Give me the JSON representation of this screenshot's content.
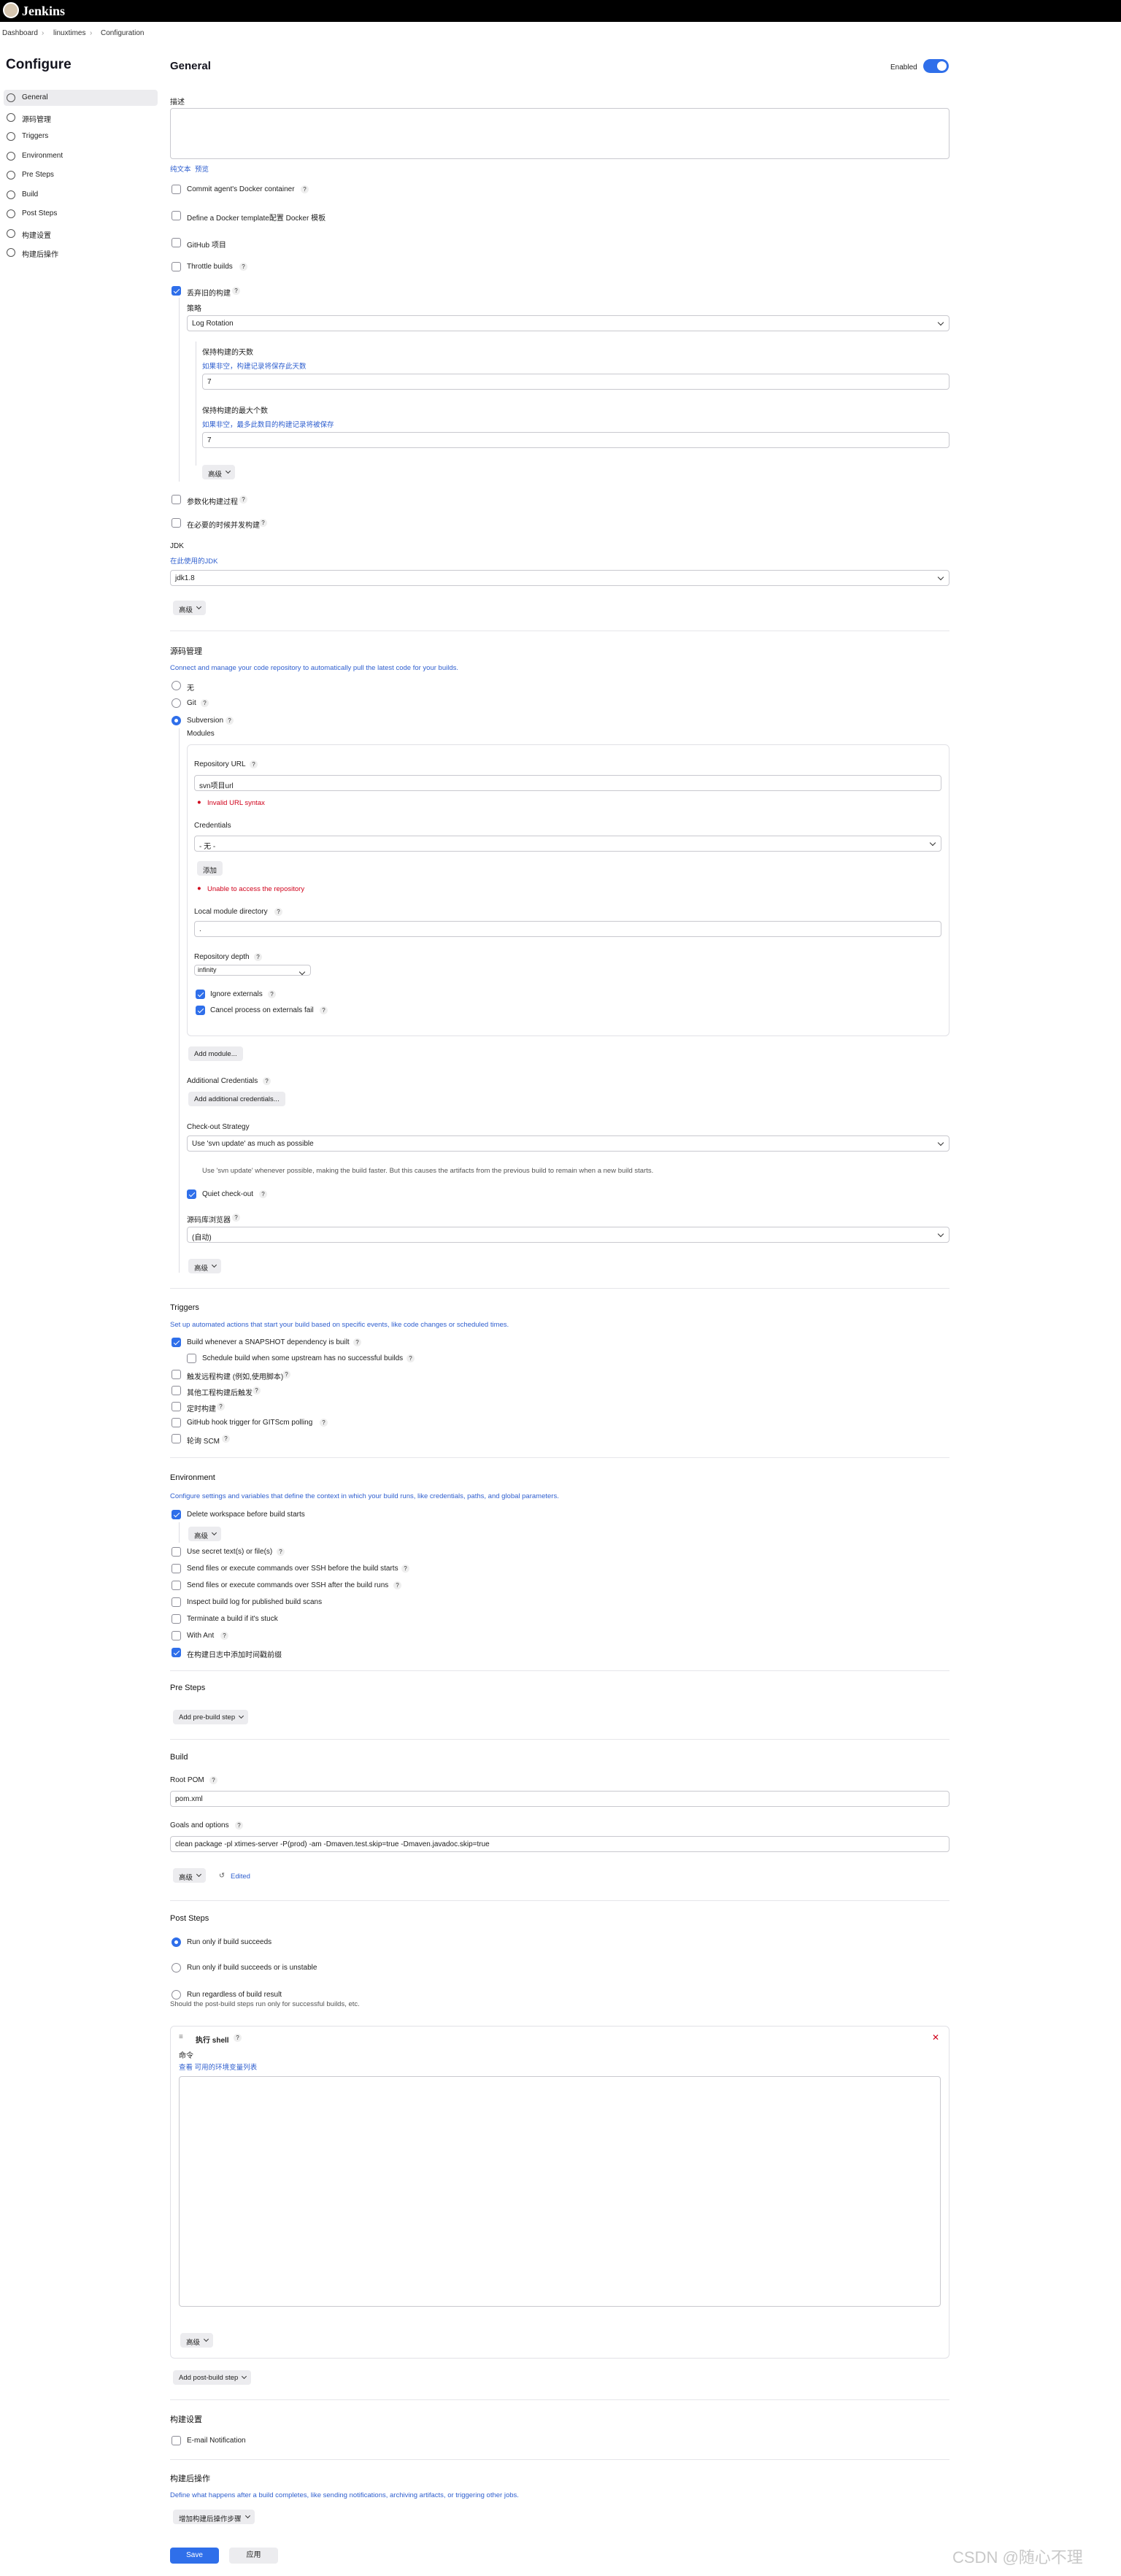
{
  "app": {
    "brand": "Jenkins"
  },
  "breadcrumb": [
    "Dashboard",
    "linuxtimes",
    "Configuration"
  ],
  "page_title": "Configure",
  "sidebar": [
    "General",
    "源码管理",
    "Triggers",
    "Environment",
    "Pre Steps",
    "Build",
    "Post Steps",
    "构建设置",
    "构建后操作"
  ],
  "general": {
    "title": "General",
    "enabled": "Enabled",
    "desc_label": "描述",
    "plain_text": "纯文本",
    "preview": "预览",
    "opts": [
      "Commit agent's Docker container",
      "Define a Docker template配置 Docker 模板",
      "GitHub 项目",
      "Throttle builds",
      "丢弃旧的构建"
    ],
    "strategy_label": "策略",
    "strategy": "Log Rotation",
    "keep_days_label": "保持构建的天数",
    "keep_days_hint": "如果非空，构建记录将保存此天数",
    "keep_days": "7",
    "keep_max_label": "保持构建的最大个数",
    "keep_max_hint": "如果非空，最多此数目的构建记录将被保存",
    "keep_max": "7",
    "advanced": "高级",
    "opts2": [
      "参数化构建过程",
      "在必要的时候并发构建"
    ],
    "jdk_label": "JDK",
    "jdk_hint": "在此使用的JDK",
    "jdk": "jdk1.8"
  },
  "scm": {
    "title": "源码管理",
    "desc": "Connect and manage your code repository to automatically pull the latest code for your builds.",
    "none": "无",
    "git": "Git",
    "svn": "Subversion",
    "modules": "Modules",
    "repo_label": "Repository URL",
    "repo": "svn项目url",
    "repo_err": "Invalid URL syntax",
    "cred_label": "Credentials",
    "cred": "- 无 -",
    "add": "添加",
    "cred_err": "Unable to access the repository",
    "local_label": "Local module directory",
    "local": ".",
    "depth_label": "Repository depth",
    "depth": "infinity",
    "ignore": "Ignore externals",
    "cancel": "Cancel process on externals fail",
    "add_module": "Add module...",
    "addl_label": "Additional Credentials",
    "addl_btn": "Add additional credentials...",
    "checkout_label": "Check-out Strategy",
    "checkout": "Use 'svn update' as much as possible",
    "checkout_desc": "Use 'svn update' whenever possible, making the build faster. But this causes the artifacts from the previous build to remain when a new build starts.",
    "quiet": "Quiet check-out",
    "browser_label": "源码库浏览器",
    "browser": "(自动)",
    "advanced": "高级"
  },
  "triggers": {
    "title": "Triggers",
    "desc": "Set up automated actions that start your build based on specific events, like code changes or scheduled times.",
    "items": [
      "Build whenever a SNAPSHOT dependency is built",
      "Schedule build when some upstream has no successful builds",
      "触发远程构建 (例如,使用脚本)",
      "其他工程构建后触发",
      "定时构建",
      "GitHub hook trigger for GITScm polling",
      "轮询 SCM"
    ]
  },
  "environment": {
    "title": "Environment",
    "desc": "Configure settings and variables that define the context in which your build runs, like credentials, paths, and global parameters.",
    "delete_ws": "Delete workspace before build starts",
    "advanced": "高级",
    "items": [
      "Use secret text(s) or file(s)",
      "Send files or execute commands over SSH before the build starts",
      "Send files or execute commands over SSH after the build runs",
      "Inspect build log for published build scans",
      "Terminate a build if it's stuck",
      "With Ant",
      "在构建日志中添加时间戳前缀"
    ]
  },
  "presteps": {
    "title": "Pre Steps",
    "add": "Add pre-build step"
  },
  "build": {
    "title": "Build",
    "root_label": "Root POM",
    "root": "pom.xml",
    "goals_label": "Goals and options",
    "goals": "clean  package -pl xtimes-server -P(prod) -am -Dmaven.test.skip=true -Dmaven.javadoc.skip=true",
    "advanced": "高级",
    "edited": "Edited"
  },
  "poststeps": {
    "title": "Post Steps",
    "r1": "Run only if build succeeds",
    "r2": "Run only if build succeeds or is unstable",
    "r3": "Run regardless of build result",
    "r3_desc": "Should the post-build steps run only for successful builds, etc.",
    "shell": "执行 shell",
    "cmd_label": "命令",
    "cmd_hint": "查看 可用的环境变量列表",
    "advanced": "高级",
    "add": "Add post-build step"
  },
  "settings": {
    "title": "构建设置",
    "email": "E-mail Notification"
  },
  "post": {
    "title": "构建后操作",
    "desc": "Define what happens after a build completes, like sending notifications, archiving artifacts, or triggering other jobs.",
    "add": "增加构建后操作步骤"
  },
  "actions": {
    "save": "Save",
    "apply": "应用"
  },
  "watermark": "CSDN @随心不理"
}
